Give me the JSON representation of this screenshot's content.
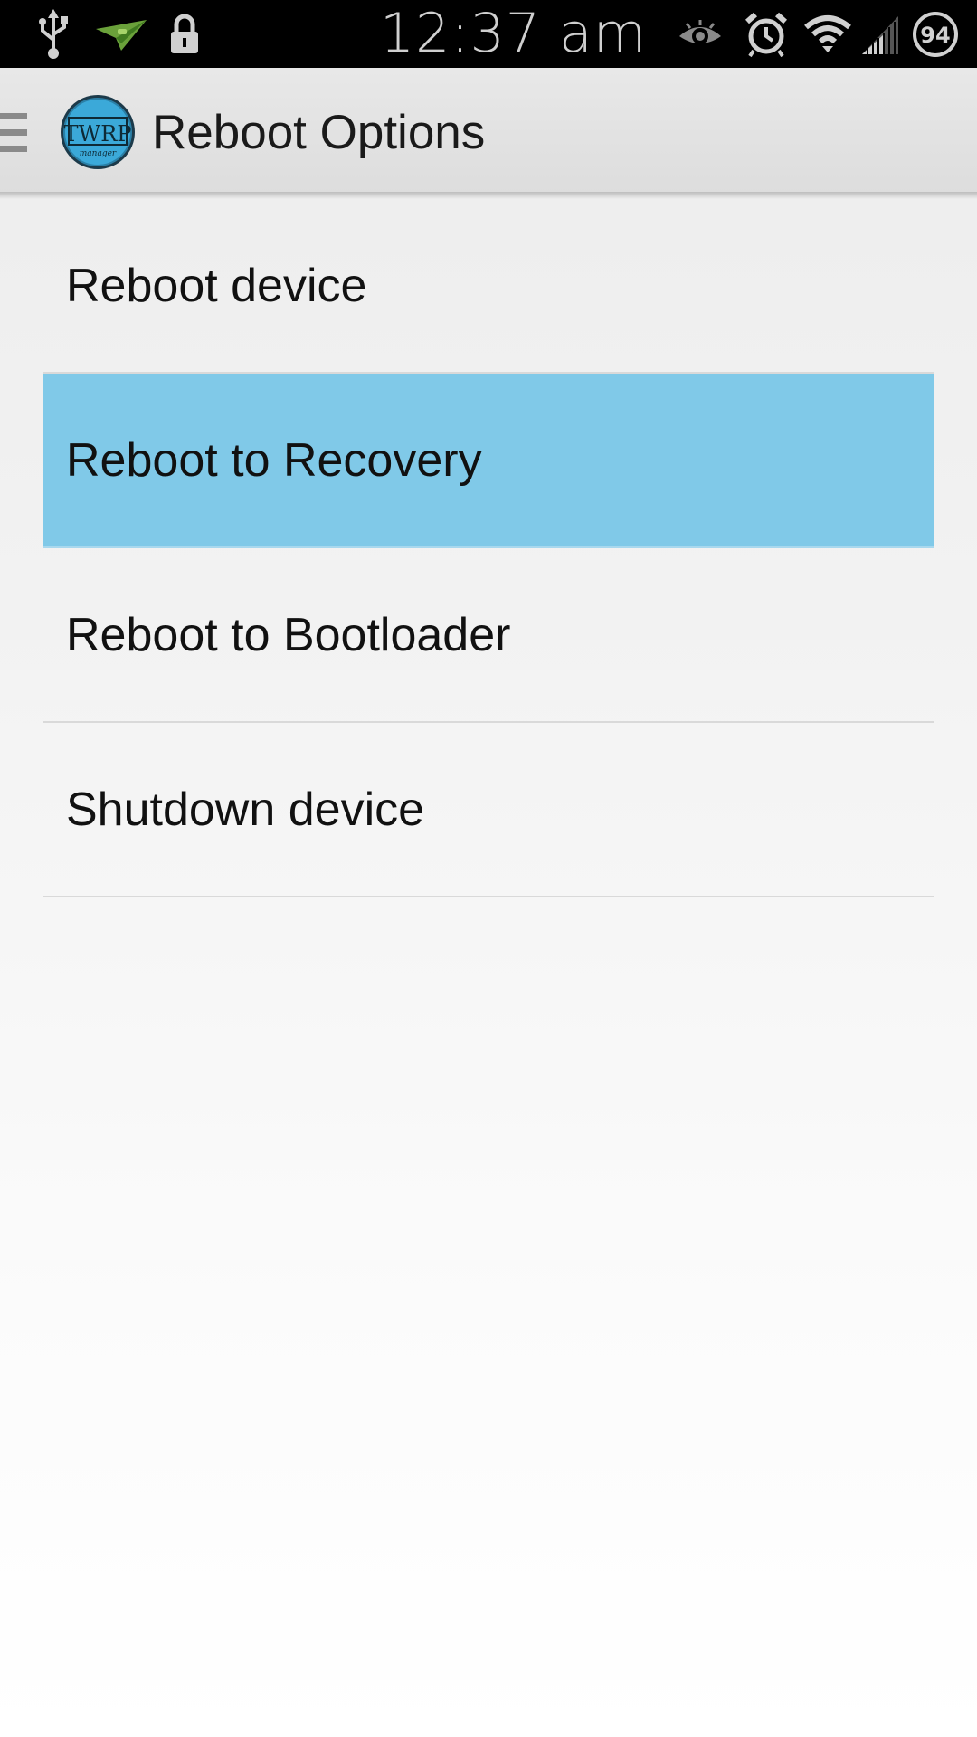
{
  "status_bar": {
    "time": "12:37 am",
    "battery_level": "94",
    "icons": [
      "usb-icon",
      "airdroid-icon",
      "lock-icon",
      "eye-icon",
      "alarm-icon",
      "wifi-icon",
      "signal-icon",
      "battery-icon"
    ]
  },
  "action_bar": {
    "title": "Reboot Options",
    "logo_text": "TWRP",
    "logo_subtext": "manager"
  },
  "options": [
    {
      "label": "Reboot device",
      "selected": false
    },
    {
      "label": "Reboot to Recovery",
      "selected": true
    },
    {
      "label": "Reboot to Bootloader",
      "selected": false
    },
    {
      "label": "Shutdown device",
      "selected": false
    }
  ],
  "colors": {
    "selected_background": "#80c9e8",
    "logo_blue": "#3ba9d9"
  }
}
